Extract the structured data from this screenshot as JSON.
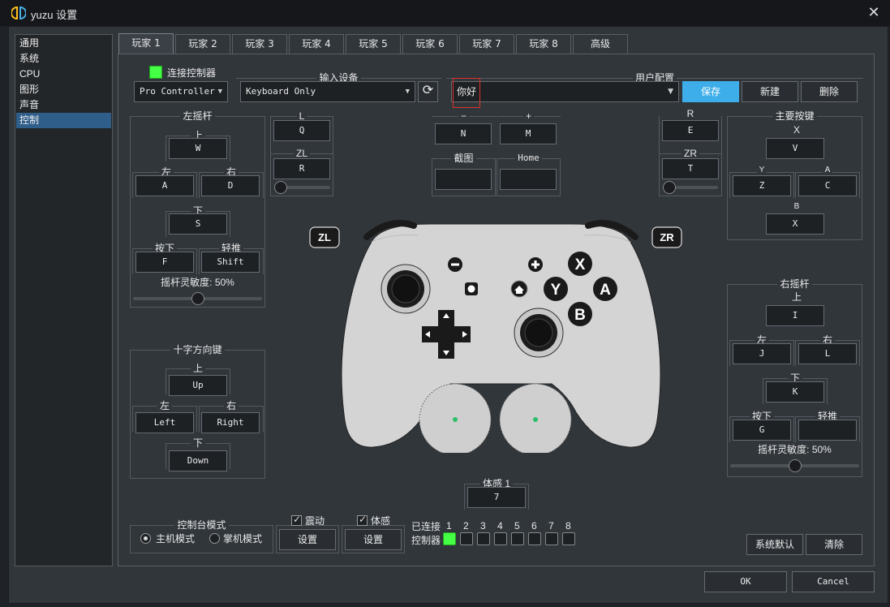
{
  "window": {
    "title": "yuzu 设置",
    "close": "✕"
  },
  "sidebar": [
    "通用",
    "系统",
    "CPU",
    "图形",
    "声音",
    "控制"
  ],
  "tabs": [
    "玩家 1",
    "玩家 2",
    "玩家 3",
    "玩家 4",
    "玩家 5",
    "玩家 6",
    "玩家 7",
    "玩家 8",
    "高级"
  ],
  "connect": {
    "label": "连接控制器",
    "type": "Pro Controller",
    "checked_color": "#44ff44"
  },
  "input": {
    "title": "输入设备",
    "device": "Keyboard Only",
    "refresh": "⟳"
  },
  "profile": {
    "title": "用户配置",
    "name": "你好",
    "save": "保存",
    "new": "新建",
    "delete": "删除"
  },
  "left_stick": {
    "title": "左摇杆",
    "up_l": "上",
    "up": "W",
    "left_l": "左",
    "left": "A",
    "right_l": "右",
    "right": "D",
    "down_l": "下",
    "down": "S",
    "press_l": "按下",
    "press": "F",
    "mod_l": "轻推",
    "mod": "Shift",
    "sens": "摇杆灵敏度: 50%",
    "sens_value": 50
  },
  "shoulders_left": {
    "l_l": "L",
    "l": "Q",
    "zl_l": "ZL",
    "zl": "R",
    "zl_value": 0
  },
  "center": {
    "minus_l": "−",
    "minus": "N",
    "plus_l": "+",
    "plus": "M",
    "cap_l": "截图",
    "cap": "",
    "home_l": "Home",
    "home": ""
  },
  "shoulders_right": {
    "r_l": "R",
    "r": "E",
    "zr_l": "ZR",
    "zr": "T",
    "zr_value": 0
  },
  "face": {
    "title": "主要按键",
    "x_l": "X",
    "x": "V",
    "y_l": "Y",
    "y": "Z",
    "a_l": "A",
    "a": "C",
    "b_l": "B",
    "b": "X"
  },
  "right_stick": {
    "title": "右摇杆",
    "up_l": "上",
    "up": "I",
    "left_l": "左",
    "left": "J",
    "right_l": "右",
    "right": "L",
    "down_l": "下",
    "down": "K",
    "press_l": "按下",
    "press": "G",
    "mod_l": "轻推",
    "mod": "",
    "sens": "摇杆灵敏度: 50%",
    "sens_value": 50
  },
  "dpad": {
    "title": "十字方向键",
    "up_l": "上",
    "up": "Up",
    "left_l": "左",
    "left": "Left",
    "right_l": "右",
    "right": "Right",
    "down_l": "下",
    "down": "Down"
  },
  "motion": {
    "title": "体感 1",
    "key": "7"
  },
  "controller_img": {
    "zl": "ZL",
    "zr": "ZR",
    "x": "X",
    "y": "Y",
    "a": "A",
    "b": "B",
    "minus": "−",
    "plus": "+"
  },
  "console_mode": {
    "title": "控制台模式",
    "docked": "主机模式",
    "handheld": "掌机模式",
    "selected": "docked"
  },
  "vibration": {
    "label": "震动",
    "settings": "设置",
    "checked": true
  },
  "motion_cfg": {
    "label": "体感",
    "settings": "设置",
    "checked": true
  },
  "connected": {
    "label1": "已连接",
    "label2": "控制器",
    "numbers": [
      "1",
      "2",
      "3",
      "4",
      "5",
      "6",
      "7",
      "8"
    ],
    "active_color": "#44ff44"
  },
  "bottom": {
    "defaults": "系统默认",
    "clear": "清除",
    "ok": "OK",
    "cancel": "Cancel"
  }
}
